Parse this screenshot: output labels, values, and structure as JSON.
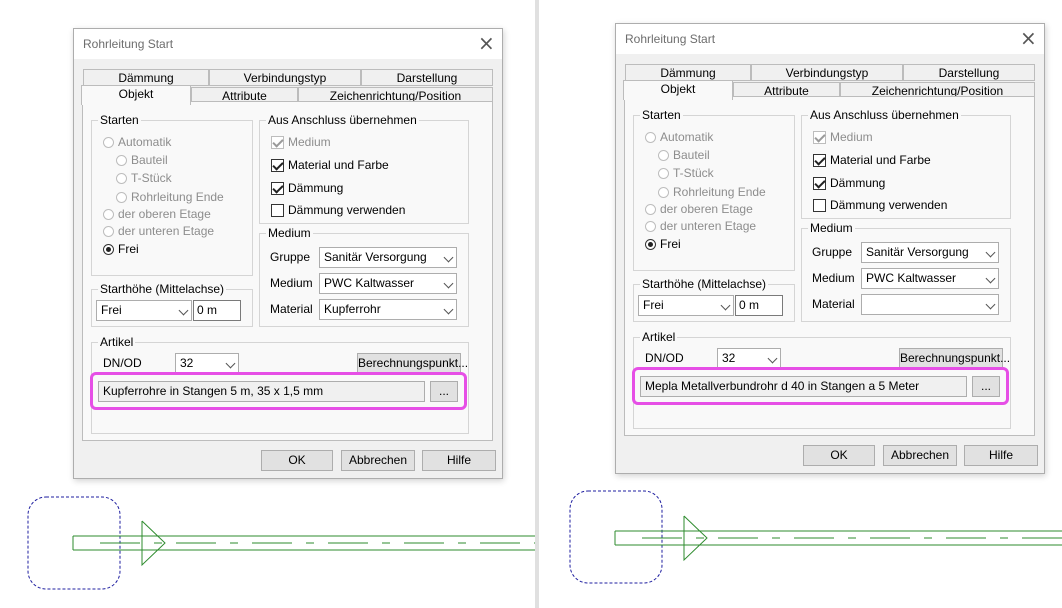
{
  "divider_color": "#e0e0e0",
  "highlight_color": "#e64fe6",
  "drawing_color": "#2e8b2e",
  "outline_color": "#1f1fa0",
  "left": {
    "dialog": {
      "title": "Rohrleitung Start",
      "close_icon": "×",
      "tabs_row1": [
        "Dämmung",
        "Verbindungstyp",
        "Darstellung"
      ],
      "tabs_row2": [
        "Objekt",
        "Attribute",
        "Zeichenrichtung/Position"
      ],
      "starten": {
        "label": "Starten",
        "automatik": "Automatik",
        "bauteil": "Bauteil",
        "tstueck": "T-Stück",
        "rohrende": "Rohrleitung Ende",
        "obere": "der oberen Etage",
        "untere": "der unteren Etage",
        "frei": "Frei"
      },
      "anschluss": {
        "label": "Aus Anschluss übernehmen",
        "medium": "Medium",
        "material_farbe": "Material und Farbe",
        "daemmung": "Dämmung",
        "daemmung_verwenden": "Dämmung verwenden"
      },
      "medium_group": {
        "label": "Medium",
        "gruppe_label": "Gruppe",
        "gruppe_value": "Sanitär Versorgung",
        "medium_label": "Medium",
        "medium_value": "PWC  Kaltwasser",
        "material_label": "Material",
        "material_value": "Kupferrohr"
      },
      "starthoehe": {
        "label": "Starthöhe (Mittelachse)",
        "mode": "Frei",
        "value": "0 m"
      },
      "artikel": {
        "label": "Artikel",
        "dnod_label": "DN/OD",
        "dnod_value": "32",
        "berechnung": "Berechnungspunkt...",
        "description": "Kupferrohre in Stangen 5 m, 35 x 1,5 mm",
        "browse": "..."
      },
      "ok": "OK",
      "abbrechen": "Abbrechen",
      "hilfe": "Hilfe"
    }
  },
  "right": {
    "dialog": {
      "title": "Rohrleitung Start",
      "close_icon": "×",
      "tabs_row1": [
        "Dämmung",
        "Verbindungstyp",
        "Darstellung"
      ],
      "tabs_row2": [
        "Objekt",
        "Attribute",
        "Zeichenrichtung/Position"
      ],
      "starten": {
        "label": "Starten",
        "automatik": "Automatik",
        "bauteil": "Bauteil",
        "tstueck": "T-Stück",
        "rohrende": "Rohrleitung Ende",
        "obere": "der oberen Etage",
        "untere": "der unteren Etage",
        "frei": "Frei"
      },
      "anschluss": {
        "label": "Aus Anschluss übernehmen",
        "medium": "Medium",
        "material_farbe": "Material und Farbe",
        "daemmung": "Dämmung",
        "daemmung_verwenden": "Dämmung verwenden"
      },
      "medium_group": {
        "label": "Medium",
        "gruppe_label": "Gruppe",
        "gruppe_value": "Sanitär Versorgung",
        "medium_label": "Medium",
        "medium_value": "PWC  Kaltwasser",
        "material_label": "Material",
        "material_value": ""
      },
      "starthoehe": {
        "label": "Starthöhe (Mittelachse)",
        "mode": "Frei",
        "value": "0 m"
      },
      "artikel": {
        "label": "Artikel",
        "dnod_label": "DN/OD",
        "dnod_value": "32",
        "berechnung": "Berechnungspunkt...",
        "description": "Mepla Metallverbundrohr d 40 in Stangen a 5 Meter",
        "browse": "..."
      },
      "ok": "OK",
      "abbrechen": "Abbrechen",
      "hilfe": "Hilfe"
    }
  }
}
